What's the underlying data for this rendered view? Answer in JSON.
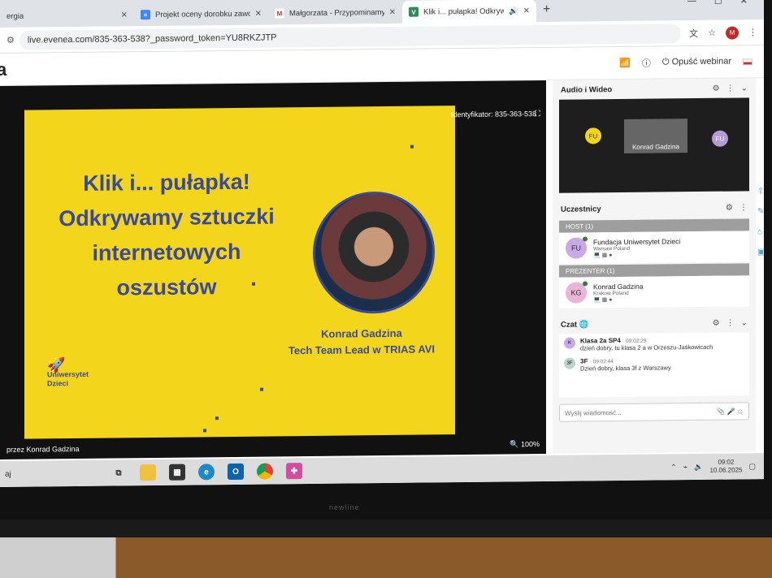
{
  "browser": {
    "tabs": [
      {
        "label": "ergia",
        "icon": "tab-favicon",
        "color": "#ffffff"
      },
      {
        "label": "Projekt oceny dorobku zawodo",
        "icon": "docs-icon",
        "color": "#4285f4"
      },
      {
        "label": "Małgorzata - Przypominamy o",
        "icon": "gmail-icon",
        "color": "#d93025"
      },
      {
        "label": "Klik i... pułapka! Odkrywamy",
        "icon": "evenea-v-icon",
        "color": "#2e8b57"
      }
    ],
    "url": "live.evenea.com/835-363-538?_password_token=YU8RKZJTP",
    "profile_initial": "M"
  },
  "app": {
    "logo_text": "a",
    "leave_label": "Opuść webinar"
  },
  "stage": {
    "identifier": "Identyfikator: 835-363-538",
    "footer_left": "przez Konrad Gadzina",
    "zoom": "100%"
  },
  "slide": {
    "title_lines": [
      "Klik i... pułapka!",
      "Odkrywamy sztuczki",
      "internetowych",
      "oszustów"
    ],
    "speaker_name": "Konrad Gadzina",
    "speaker_role": "Tech Team Lead w TRIAS AVI",
    "logo_line1": "Uniwersytet",
    "logo_line2": "Dzieci",
    "bg_color": "#f3d51b",
    "text_color": "#3a4a9a"
  },
  "sidebar": {
    "av_title": "Audio i Wideo",
    "av_tiles": {
      "left": "FU",
      "center": "Konrad Gadzina",
      "right": "FU"
    },
    "participants_title": "Uczestnicy",
    "host_section": "HOST (1)",
    "presenter_section": "PREZENTER (1)",
    "host": {
      "initials": "FU",
      "name": "Fundacja Uniwersytet Dzieci",
      "location": "Warsaw Poland"
    },
    "presenter": {
      "initials": "KG",
      "name": "Konrad Gadzina",
      "location": "Krakow Poland"
    },
    "chat_title": "Czat",
    "messages": [
      {
        "initials": "K",
        "author": "Klasa 2a SP4",
        "time": "09:02:29",
        "text": "dzień dobry, tu klasa 2 a w Orzeszu-Jaśkowicach"
      },
      {
        "initials": "3F",
        "author": "3F",
        "time": "09:02:44",
        "text": "Dzień dobry, klasa 3f z Warszawy"
      }
    ],
    "chat_placeholder": "Wyślij wiadomość..."
  },
  "taskbar": {
    "left_text": "aj",
    "time": "09:02",
    "date": "10.06.2025"
  },
  "monitor_brand": "newline"
}
